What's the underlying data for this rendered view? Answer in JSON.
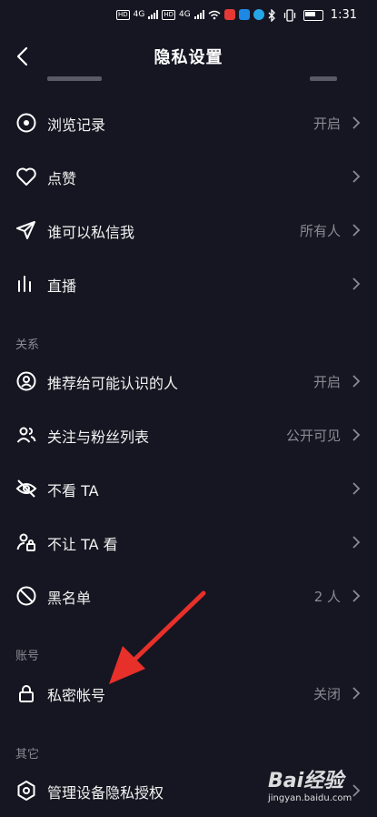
{
  "status_bar": {
    "hd1": "HD",
    "hd2": "HD",
    "net1": "4G",
    "net2": "4G",
    "time": "1:31"
  },
  "header": {
    "title": "隐私设置"
  },
  "rows": [
    {
      "label": "浏览记录",
      "value": "开启",
      "icon": "eye-icon"
    },
    {
      "label": "点赞",
      "value": "",
      "icon": "heart-icon"
    },
    {
      "label": "谁可以私信我",
      "value": "所有人",
      "icon": "send-icon"
    },
    {
      "label": "直播",
      "value": "",
      "icon": "live-bars-icon"
    }
  ],
  "sections": {
    "relations": "关系",
    "account": "账号",
    "other": "其它"
  },
  "relation_rows": [
    {
      "label": "推荐给可能认识的人",
      "value": "开启",
      "icon": "user-circle-icon"
    },
    {
      "label": "关注与粉丝列表",
      "value": "公开可见",
      "icon": "users-icon"
    },
    {
      "label": "不看 TA",
      "value": "",
      "icon": "eye-off-icon"
    },
    {
      "label": "不让 TA 看",
      "value": "",
      "icon": "user-lock-icon"
    },
    {
      "label": "黑名单",
      "value": "2 人",
      "icon": "block-icon"
    }
  ],
  "account_rows": [
    {
      "label": "私密帐号",
      "value": "关闭",
      "icon": "lock-icon"
    }
  ],
  "other_rows": [
    {
      "label": "管理设备隐私授权",
      "value": "",
      "icon": "hexagon-settings-icon"
    }
  ],
  "watermark": {
    "brand": "Bai经验",
    "url": "jingyan.baidu.com"
  },
  "colors": {
    "background": "#161622",
    "secondary_text": "#8a8a94",
    "annotation_arrow": "#e8302a"
  }
}
